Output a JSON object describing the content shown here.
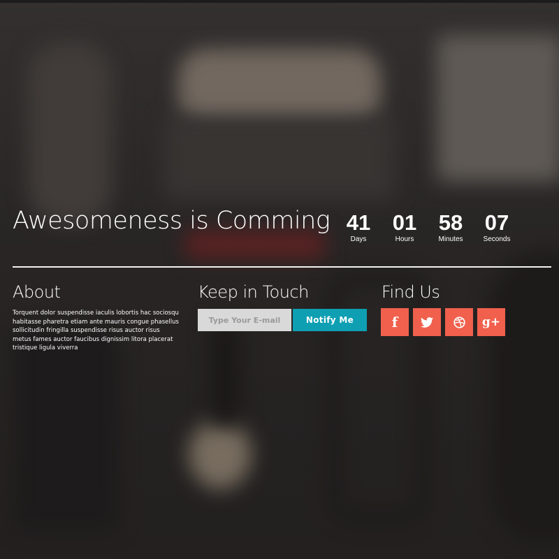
{
  "hero": {
    "headline": "Awesomeness is Comming"
  },
  "countdown": [
    {
      "value": "41",
      "label": "Days"
    },
    {
      "value": "01",
      "label": "Hours"
    },
    {
      "value": "58",
      "label": "Minutes"
    },
    {
      "value": "07",
      "label": "Seconds"
    }
  ],
  "about": {
    "title": "About",
    "text": "Torquent dolor suspendisse iaculis lobortis hac sociosqu habitasse pharetra etiam ante mauris congue phasellus sollicitudin fringilla suspendisse risus auctor risus metus fames auctor faucibus dignissim litora placerat tristique ligula viverra"
  },
  "keep_in_touch": {
    "title": "Keep in Touch",
    "email_placeholder": "Type Your E-mail",
    "email_value": "",
    "button_label": "Notify Me"
  },
  "find_us": {
    "title": "Find Us",
    "socials": [
      {
        "name": "facebook-icon",
        "glyph": "f"
      },
      {
        "name": "twitter-icon",
        "glyph": ""
      },
      {
        "name": "dribbble-icon",
        "glyph": ""
      },
      {
        "name": "google-plus-icon",
        "glyph": "g+"
      }
    ]
  },
  "colors": {
    "accent_button": "#0f9fb3",
    "social_button": "#f0604d",
    "input_bg": "#d9d9d9"
  }
}
